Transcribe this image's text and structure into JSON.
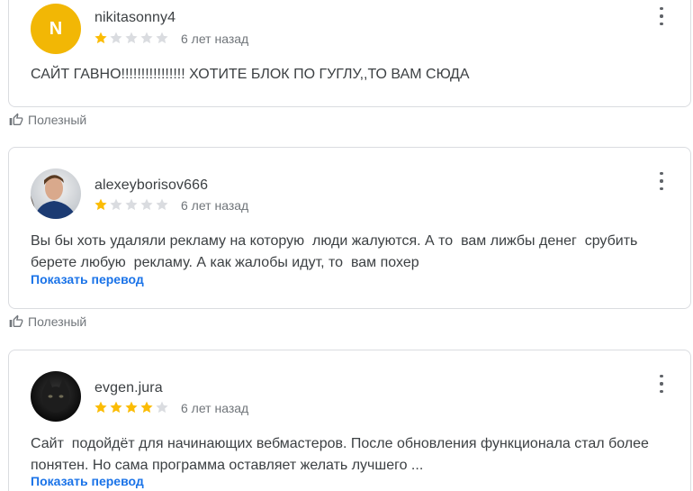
{
  "reviews": [
    {
      "avatar_letter": "N",
      "avatar_color": "#f2b705",
      "username": "nikitasonny4",
      "rating": 1,
      "max_rating": 5,
      "date": "6 лет назад",
      "text": "САЙТ ГАВНО!!!!!!!!!!!!!!!! ХОТИТЕ БЛОК ПО ГУГЛУ,,ТО ВАМ СЮДА",
      "translate_label": "",
      "helpful_label": "Полезный"
    },
    {
      "avatar_letter": "",
      "avatar_color": "#2d4060",
      "username": "alexeyborisov666",
      "rating": 1,
      "max_rating": 5,
      "date": "6 лет назад",
      "text": "Вы бы хоть удаляли рекламу на которую  люди жалуются. А то  вам лижбы денег  срубить\nберете любую  рекламу. А как жалобы идут, то  вам похер",
      "translate_label": "Показать перевод",
      "helpful_label": "Полезный"
    },
    {
      "avatar_letter": "",
      "avatar_color": "#1a1a1a",
      "username": "evgen.jura",
      "rating": 4,
      "max_rating": 5,
      "date": "6 лет назад",
      "text": "Сайт  подойдёт для начинающих вебмастеров. После обновления функционала стал более\nпонятен. Но сама программа оставляет желать лучшего ...",
      "translate_label": "Показать перевод",
      "helpful_label": ""
    }
  ],
  "colors": {
    "star_filled": "#fbbc04",
    "star_empty": "#dadce0",
    "link": "#1a73e8",
    "muted": "#70757a"
  },
  "icons": {
    "menu": "more-vert-icon",
    "helpful": "thumb-up-icon",
    "star": "star-icon"
  }
}
